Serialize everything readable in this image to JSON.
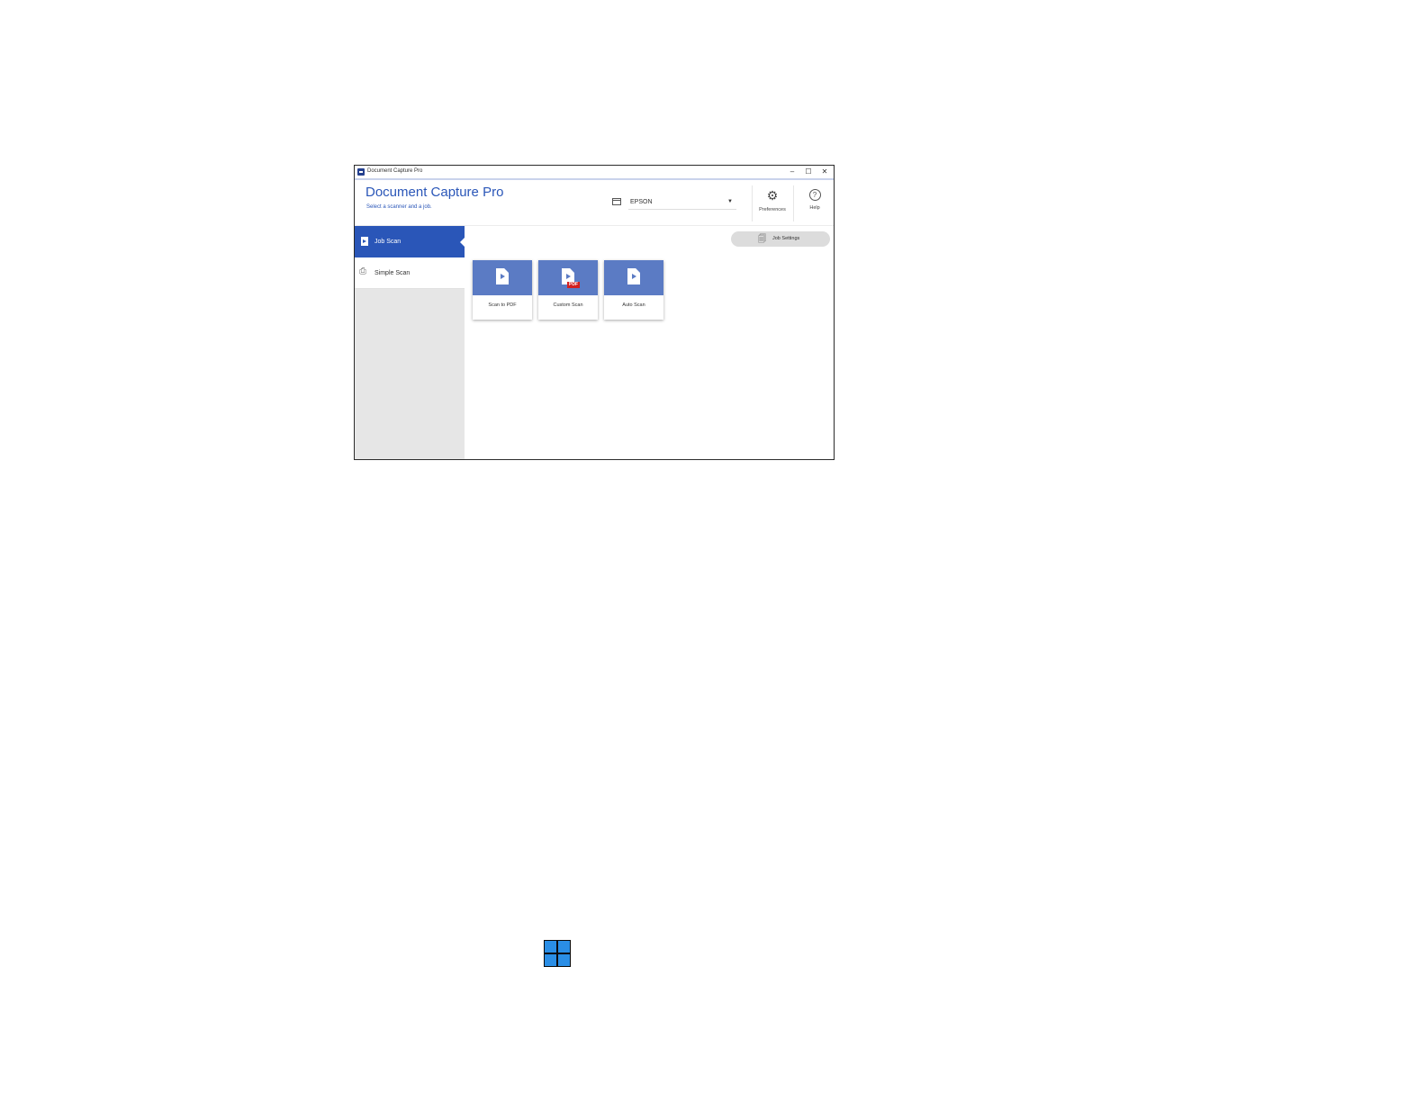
{
  "window": {
    "title": "Document Capture Pro",
    "controls": {
      "minimize": "–",
      "maximize": "☐",
      "close": "✕"
    }
  },
  "header": {
    "app_title": "Document Capture Pro",
    "subtitle": "Select a scanner and a job.",
    "scanner": {
      "selected": "EPSON"
    },
    "preferences_label": "Preferences",
    "help_label": "Help"
  },
  "sidebar": {
    "items": [
      {
        "label": "Job Scan",
        "icon": "document-play-icon",
        "active": true
      },
      {
        "label": "Simple Scan",
        "icon": "scanner-icon",
        "active": false
      }
    ]
  },
  "content": {
    "job_settings_label": "Job Settings",
    "jobs": [
      {
        "label": "Scan to PDF",
        "icon": "document-play-icon"
      },
      {
        "label": "Custom Scan",
        "icon": "pdf-document-icon",
        "badge": "PDF"
      },
      {
        "label": "Auto Scan",
        "icon": "document-play-icon"
      }
    ]
  },
  "colors": {
    "accent": "#2a56b8",
    "tile": "#5b7bc4",
    "sidebar_bg": "#e6e6e6",
    "pdf_badge": "#d32020",
    "windows_logo": "#2a8ee6"
  },
  "windows_logo_icon": "windows-start-icon"
}
